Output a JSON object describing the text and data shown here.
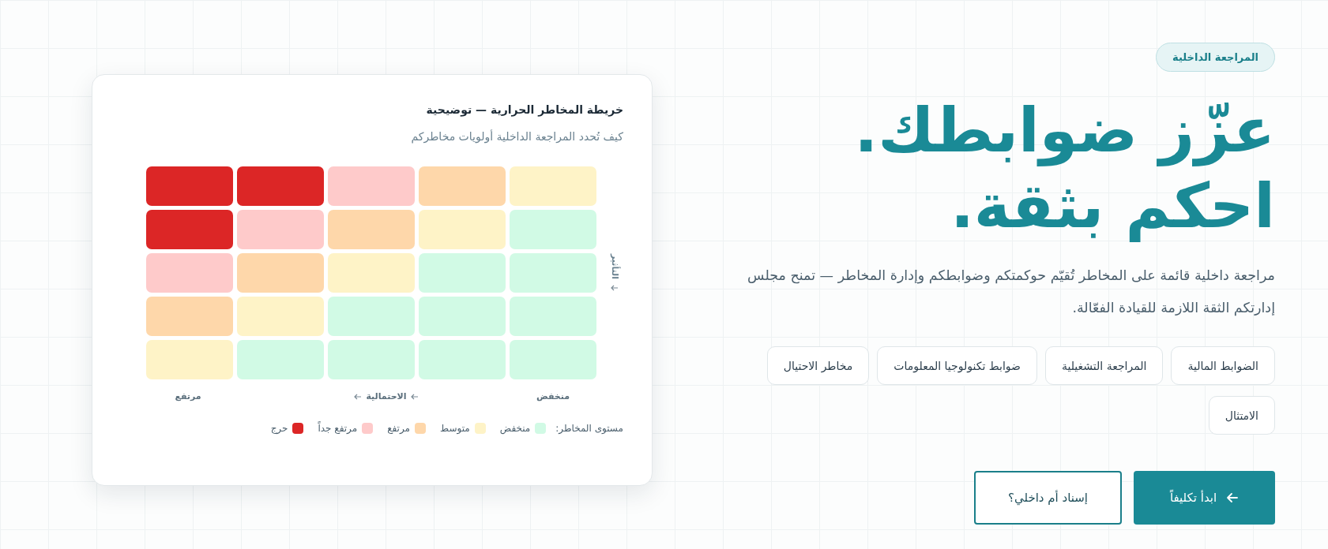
{
  "hero": {
    "badge": "المراجعة  الداخلية",
    "headline_lines": [
      "عزّز ضوابطك.",
      "احكم بثقة."
    ],
    "description": "مراجعة داخلية قائمة على المخاطر تُقيّم حوكمتكم وضوابطكم وإدارة المخاطر — تمنح مجلس إدارتكم الثقة اللازمة للقيادة الفعّالة.",
    "tags": [
      {
        "label": "الضوابط المالية"
      },
      {
        "label": "المراجعة التشغيلية"
      },
      {
        "label": "ضوابط تكنولوجيا المعلومات"
      },
      {
        "label": "مخاطر الاحتيال"
      },
      {
        "label": "الامتثال"
      }
    ],
    "buttons": [
      {
        "label": "ابدأ تكليفاً",
        "kind": "primary"
      },
      {
        "label": "إسناد أم داخلي؟",
        "kind": "secondary"
      }
    ]
  },
  "heatmap_card": {
    "title": "خريطة المخاطر الحرارية — توضيحية",
    "subtitle": "كيف تُحدد المراجعة الداخلية أولويات مخاطركم",
    "rows": [
      {
        "cells": [
          {
            "color": "#fef3c7"
          },
          {
            "color": "#fed7aa"
          },
          {
            "color": "#fecaca"
          },
          {
            "color": "#dc2626"
          },
          {
            "color": "#dc2626"
          }
        ]
      },
      {
        "cells": [
          {
            "color": "#d1fae5"
          },
          {
            "color": "#fef3c7"
          },
          {
            "color": "#fed7aa"
          },
          {
            "color": "#fecaca"
          },
          {
            "color": "#dc2626"
          }
        ]
      },
      {
        "cells": [
          {
            "color": "#d1fae5"
          },
          {
            "color": "#d1fae5"
          },
          {
            "color": "#fef3c7"
          },
          {
            "color": "#fed7aa"
          },
          {
            "color": "#fecaca"
          }
        ]
      },
      {
        "cells": [
          {
            "color": "#d1fae5"
          },
          {
            "color": "#d1fae5"
          },
          {
            "color": "#d1fae5"
          },
          {
            "color": "#fef3c7"
          },
          {
            "color": "#fed7aa"
          }
        ]
      },
      {
        "cells": [
          {
            "color": "#d1fae5"
          },
          {
            "color": "#d1fae5"
          },
          {
            "color": "#d1fae5"
          },
          {
            "color": "#d1fae5"
          },
          {
            "color": "#fef3c7"
          }
        ]
      }
    ],
    "y_axis_label": "التأثير",
    "x_axis_low": "منخفض",
    "x_axis_label": "الاحتمالية",
    "x_axis_high": "مرتفع",
    "legend_title": "مستوى المخاطر:",
    "legend": [
      {
        "label": "منخفض",
        "color": "#d1fae5"
      },
      {
        "label": "متوسط",
        "color": "#fef3c7"
      },
      {
        "label": "مرتفع",
        "color": "#fed7aa"
      },
      {
        "label": "مرتفع جداً",
        "color": "#fecaca"
      },
      {
        "label": "حرج",
        "color": "#dc2626"
      }
    ]
  }
}
